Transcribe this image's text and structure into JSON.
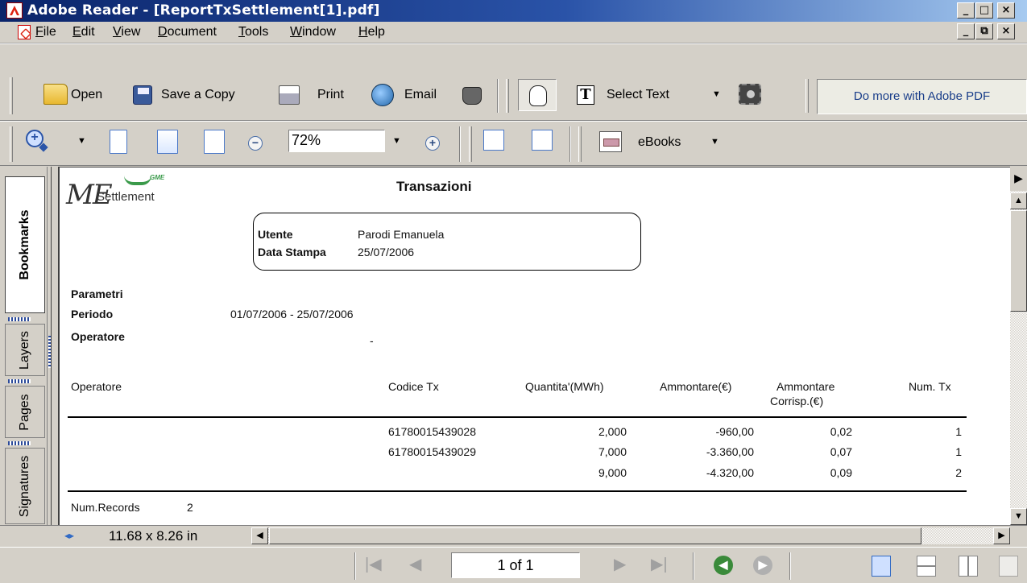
{
  "window": {
    "title": "Adobe Reader - [ReportTxSettlement[1].pdf]",
    "controls": {
      "minimize": "_",
      "maximize": "□",
      "close": "×",
      "restore": "⧉"
    }
  },
  "menu": {
    "items": [
      {
        "label": "File",
        "key": "F",
        "rest": "ile"
      },
      {
        "label": "Edit",
        "key": "E",
        "rest": "dit"
      },
      {
        "label": "View",
        "key": "V",
        "rest": "iew"
      },
      {
        "label": "Document",
        "key": "D",
        "rest": "ocument"
      },
      {
        "label": "Tools",
        "key": "T",
        "rest": "ools"
      },
      {
        "label": "Window",
        "key": "W",
        "rest": "indow"
      },
      {
        "label": "Help",
        "key": "H",
        "rest": "elp"
      }
    ]
  },
  "toolbar1": {
    "open": "Open",
    "save_copy": "Save a Copy",
    "print": "Print",
    "email": "Email",
    "select_text": "Select Text",
    "promo": "Do more with Adobe PDF"
  },
  "toolbar2": {
    "zoom_value": "72%",
    "ebooks": "eBooks"
  },
  "nav_tabs": [
    "Bookmarks",
    "Layers",
    "Pages",
    "Signatures"
  ],
  "document": {
    "logo_me": "ME",
    "logo_settlement": "Settlement",
    "logo_gme": "GME",
    "title": "Transazioni",
    "info": {
      "utente_label": "Utente",
      "utente_value": "Parodi Emanuela",
      "data_label": "Data Stampa",
      "data_value": "25/07/2006"
    },
    "parametri": "Parametri",
    "periodo_label": "Periodo",
    "periodo_value": "01/07/2006 - 25/07/2006",
    "operatore_label": "Operatore",
    "operatore_value": "-",
    "columns": {
      "operatore": "Operatore",
      "codice": "Codice Tx",
      "quantita": "Quantita'(MWh)",
      "ammontare": "Ammontare(€)",
      "ammontare_corr_1": "Ammontare",
      "ammontare_corr_2": "Corrisp.(€)",
      "num_tx": "Num. Tx"
    },
    "rows": [
      {
        "codice": "61780015439028",
        "quantita": "2,000",
        "ammontare": "-960,00",
        "corrisp": "0,02",
        "num": "1"
      },
      {
        "codice": "61780015439029",
        "quantita": "7,000",
        "ammontare": "-3.360,00",
        "corrisp": "0,07",
        "num": "1"
      },
      {
        "codice": "",
        "quantita": "9,000",
        "ammontare": "-4.320,00",
        "corrisp": "0,09",
        "num": "2"
      }
    ],
    "num_records_label": "Num.Records",
    "num_records_value": "2"
  },
  "status": {
    "page_size": "11.68 x 8.26 in",
    "page_indicator": "1 of 1"
  },
  "colors": {
    "title_bar_start": "#0a246a",
    "title_bar_end": "#a6caf0",
    "chrome": "#d4d0c8",
    "promo_text": "#1a3e8a"
  }
}
